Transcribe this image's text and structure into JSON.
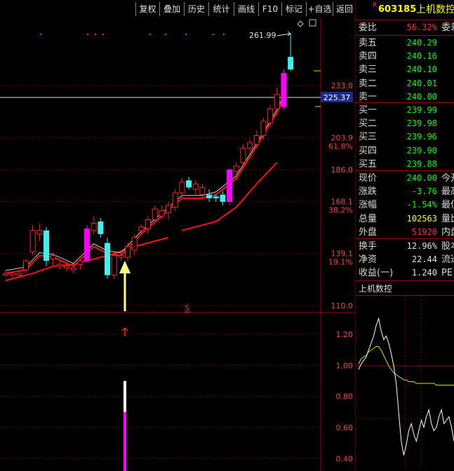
{
  "toolbar": {
    "buttons": [
      "复权",
      "叠加",
      "历史",
      "统计",
      "画线",
      "F10",
      "标记",
      "+自选",
      "返回"
    ]
  },
  "stock": {
    "badge": "R",
    "code": "603185",
    "name": "上机数控"
  },
  "chart": {
    "peak_label": "261.99",
    "price_ticks": [
      {
        "value": "233.0",
        "pct": ""
      },
      {
        "value": "203.9",
        "pct": "61.8%"
      },
      {
        "value": "186.0",
        "pct": ""
      },
      {
        "value": "168.1",
        "pct": "38.2%"
      },
      {
        "value": "139.1",
        "pct": "19.1%"
      },
      {
        "value": "110.0",
        "pct": ""
      }
    ],
    "crosshair_price": "225.37",
    "signal_marker": "S",
    "indicator_ticks": [
      "1.20",
      "1.00",
      "0.80",
      "0.60",
      "0.40"
    ]
  },
  "chart_data": {
    "type": "candlestick",
    "ylim": [
      110,
      262
    ],
    "candles": [
      {
        "o": 128,
        "h": 130,
        "l": 126,
        "c": 127,
        "k": "w"
      },
      {
        "o": 127,
        "h": 129,
        "l": 125,
        "c": 128,
        "k": "w"
      },
      {
        "o": 128,
        "h": 130,
        "l": 126,
        "c": 127,
        "k": "w"
      },
      {
        "o": 130,
        "h": 136,
        "l": 128,
        "c": 135,
        "k": "w"
      },
      {
        "o": 140,
        "h": 155,
        "l": 138,
        "c": 152,
        "k": "w"
      },
      {
        "o": 152,
        "h": 156,
        "l": 146,
        "c": 150,
        "k": "w"
      },
      {
        "o": 152,
        "h": 154,
        "l": 132,
        "c": 135,
        "k": "c"
      },
      {
        "o": 136,
        "h": 140,
        "l": 132,
        "c": 138,
        "k": "w"
      },
      {
        "o": 133,
        "h": 135,
        "l": 130,
        "c": 132,
        "k": "w"
      },
      {
        "o": 132,
        "h": 134,
        "l": 129,
        "c": 131,
        "k": "w"
      },
      {
        "o": 131,
        "h": 133,
        "l": 128,
        "c": 130,
        "k": "w"
      },
      {
        "o": 133,
        "h": 136,
        "l": 130,
        "c": 135,
        "k": "w"
      },
      {
        "o": 135,
        "h": 155,
        "l": 134,
        "c": 153,
        "k": "m"
      },
      {
        "o": 152,
        "h": 160,
        "l": 150,
        "c": 156,
        "k": "w"
      },
      {
        "o": 157,
        "h": 159,
        "l": 148,
        "c": 150,
        "k": "c"
      },
      {
        "o": 145,
        "h": 148,
        "l": 125,
        "c": 127,
        "k": "c"
      },
      {
        "o": 127,
        "h": 140,
        "l": 125,
        "c": 138,
        "k": "w"
      },
      {
        "o": 138,
        "h": 140,
        "l": 135,
        "c": 137,
        "k": "w"
      },
      {
        "o": 137,
        "h": 145,
        "l": 135,
        "c": 143,
        "k": "w"
      },
      {
        "o": 141,
        "h": 150,
        "l": 138,
        "c": 148,
        "k": "w"
      },
      {
        "o": 152,
        "h": 155,
        "l": 150,
        "c": 154,
        "k": "w"
      },
      {
        "o": 153,
        "h": 160,
        "l": 150,
        "c": 158,
        "k": "w"
      },
      {
        "o": 158,
        "h": 166,
        "l": 156,
        "c": 164,
        "k": "w"
      },
      {
        "o": 160,
        "h": 166,
        "l": 158,
        "c": 163,
        "k": "w"
      },
      {
        "o": 162,
        "h": 168,
        "l": 158,
        "c": 166,
        "k": "w"
      },
      {
        "o": 165,
        "h": 175,
        "l": 163,
        "c": 173,
        "k": "w"
      },
      {
        "o": 173,
        "h": 181,
        "l": 170,
        "c": 179,
        "k": "w"
      },
      {
        "o": 180,
        "h": 182,
        "l": 175,
        "c": 176,
        "k": "c"
      },
      {
        "o": 175,
        "h": 180,
        "l": 172,
        "c": 178,
        "k": "w"
      },
      {
        "o": 176,
        "h": 178,
        "l": 170,
        "c": 172,
        "k": "w"
      },
      {
        "o": 172,
        "h": 175,
        "l": 168,
        "c": 170,
        "k": "c"
      },
      {
        "o": 170,
        "h": 172,
        "l": 168,
        "c": 171,
        "k": "c"
      },
      {
        "o": 172,
        "h": 174,
        "l": 166,
        "c": 168,
        "k": "c"
      },
      {
        "o": 168,
        "h": 187,
        "l": 166,
        "c": 186,
        "k": "m"
      },
      {
        "o": 185,
        "h": 190,
        "l": 180,
        "c": 188,
        "k": "w"
      },
      {
        "o": 190,
        "h": 200,
        "l": 188,
        "c": 198,
        "k": "w"
      },
      {
        "o": 198,
        "h": 203,
        "l": 196,
        "c": 201,
        "k": "w"
      },
      {
        "o": 200,
        "h": 208,
        "l": 198,
        "c": 205,
        "k": "w"
      },
      {
        "o": 205,
        "h": 215,
        "l": 203,
        "c": 213,
        "k": "w"
      },
      {
        "o": 212,
        "h": 222,
        "l": 210,
        "c": 220,
        "k": "w"
      },
      {
        "o": 220,
        "h": 232,
        "l": 216,
        "c": 228,
        "k": "w"
      },
      {
        "o": 221,
        "h": 242,
        "l": 220,
        "c": 240,
        "k": "m"
      },
      {
        "o": 242,
        "h": 262,
        "l": 241,
        "c": 249,
        "k": "c"
      }
    ],
    "ma_short": [
      [
        0,
        128
      ],
      [
        3,
        130
      ],
      [
        5,
        138
      ],
      [
        7,
        137
      ],
      [
        10,
        132
      ],
      [
        13,
        143
      ],
      [
        15,
        139
      ],
      [
        17,
        138
      ],
      [
        20,
        150
      ],
      [
        23,
        160
      ],
      [
        26,
        170
      ],
      [
        29,
        170
      ],
      [
        31,
        172
      ],
      [
        34,
        181
      ],
      [
        37,
        199
      ],
      [
        40,
        218
      ],
      [
        41,
        226
      ]
    ],
    "ma_long": [
      [
        0,
        124
      ],
      [
        4,
        128
      ],
      [
        7,
        132
      ],
      [
        10,
        133
      ],
      [
        13,
        136
      ],
      [
        16,
        139
      ],
      [
        19,
        143
      ],
      [
        22,
        146
      ],
      [
        24,
        148
      ],
      [
        26,
        152
      ],
      [
        28,
        154
      ],
      [
        31,
        157
      ],
      [
        34,
        165
      ],
      [
        37,
        178
      ],
      [
        40,
        190
      ]
    ],
    "ma_long_gap_after": 24,
    "indicator": {
      "ylim": [
        0.32,
        1.3
      ],
      "bar_white": [
        0.9,
        0.7
      ],
      "bar_magenta": [
        0.7,
        0.32
      ]
    },
    "mini_chart": {
      "price": [
        0.93,
        0.96,
        0.98,
        1.0,
        1.04,
        1.08,
        1.12,
        1.18,
        1.22,
        1.15,
        1.1,
        1.12,
        1.08,
        1.02,
        0.95,
        0.85,
        0.68,
        0.52,
        0.44,
        0.5,
        0.58,
        0.62,
        0.56,
        0.52,
        0.58,
        0.64,
        0.6,
        0.66,
        0.7,
        0.62,
        0.58,
        0.6,
        0.66,
        0.7,
        0.62,
        0.64,
        0.66,
        0.6,
        0.52
      ],
      "avg": [
        0.96,
        0.99,
        1.0,
        1.01,
        1.03,
        1.04,
        1.05,
        1.06,
        1.06,
        1.04,
        1.01,
        0.98,
        0.95,
        0.93,
        0.91,
        0.9,
        0.89,
        0.88,
        0.87,
        0.87,
        0.86,
        0.86,
        0.86,
        0.85,
        0.85,
        0.85,
        0.85,
        0.85,
        0.85,
        0.85,
        0.85,
        0.84,
        0.84,
        0.84,
        0.84,
        0.84,
        0.84,
        0.84,
        0.84
      ],
      "ylim": [
        0.35,
        1.35
      ]
    }
  },
  "quote": {
    "wei_bi": {
      "label": "委比",
      "value": "56.32%",
      "extra": "委差",
      "color": "#ff3030"
    },
    "sell": [
      {
        "label": "卖五",
        "price": "240.29"
      },
      {
        "label": "卖四",
        "price": "240.16"
      },
      {
        "label": "卖三",
        "price": "240.10"
      },
      {
        "label": "卖二",
        "price": "240.01"
      },
      {
        "label": "卖一",
        "price": "240.00"
      }
    ],
    "buy": [
      {
        "label": "买一",
        "price": "239.99"
      },
      {
        "label": "买二",
        "price": "239.98"
      },
      {
        "label": "买三",
        "price": "239.96"
      },
      {
        "label": "买四",
        "price": "239.90"
      },
      {
        "label": "买五",
        "price": "239.88"
      }
    ],
    "stats": [
      {
        "label": "现价",
        "value": "240.00",
        "extra": "今开",
        "color": "#00ff00"
      },
      {
        "label": "涨跌",
        "value": "-3.76",
        "extra": "最高",
        "color": "#00ff00"
      },
      {
        "label": "涨幅",
        "value": "-1.54%",
        "extra": "最低",
        "color": "#00ff00"
      },
      {
        "label": "总量",
        "value": "102563",
        "extra": "量比",
        "color": "#ffff00"
      },
      {
        "label": "外盘",
        "value": "51920",
        "extra": "内盘",
        "color": "#ff3030"
      }
    ],
    "fund": [
      {
        "label": "换手",
        "value": "12.96%",
        "extra": "股本"
      },
      {
        "label": "净资",
        "value": "22.44",
        "extra": "流通"
      },
      {
        "label": "收益(一)",
        "value": "1.240",
        "extra": "PE"
      }
    ],
    "mini_title": "上机数控"
  }
}
